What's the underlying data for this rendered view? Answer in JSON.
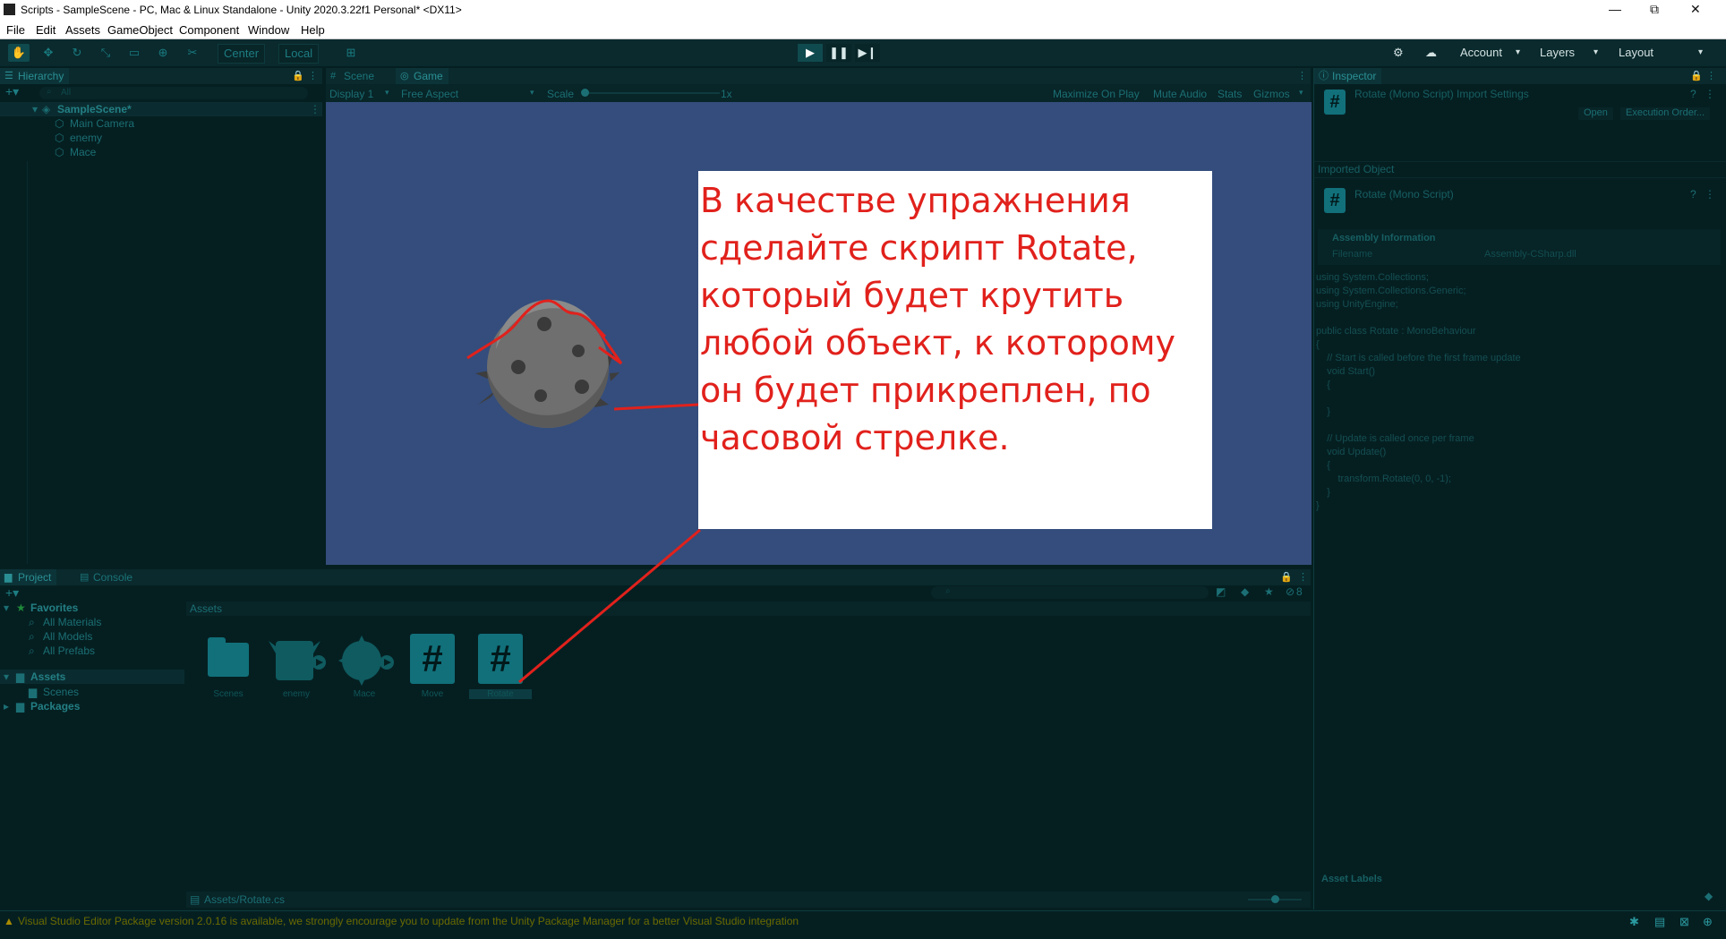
{
  "window": {
    "title": "Scripts - SampleScene - PC, Mac & Linux Standalone - Unity 2020.3.22f1 Personal* <DX11>",
    "controls": {
      "minimize": "—",
      "maximize": "⧉",
      "close": "✕"
    }
  },
  "menu": [
    "File",
    "Edit",
    "Assets",
    "GameObject",
    "Component",
    "Window",
    "Help"
  ],
  "toolbar": {
    "pivot": "Center",
    "space": "Local",
    "account": "Account",
    "layers": "Layers",
    "layout": "Layout"
  },
  "hierarchy": {
    "tab": "Hierarchy",
    "search_placeholder": "All",
    "scene": "SampleScene*",
    "items": [
      "Main Camera",
      "enemy",
      "Mace"
    ]
  },
  "scene_panel": {
    "tabs": [
      "Scene",
      "Game"
    ],
    "display": "Display 1",
    "aspect": "Free Aspect",
    "scale_label": "Scale",
    "scale_value": "1x",
    "toggles": [
      "Maximize On Play",
      "Mute Audio",
      "Stats",
      "Gizmos"
    ]
  },
  "overlay_text": "В качестве упражнения сделайте скрипт Rotate, который будет крутить любой объект, к которому он будет прикреплен, по часовой стрелке.",
  "overlay_color": "#e1211c",
  "inspector": {
    "tab": "Inspector",
    "header": "Rotate (Mono Script) Import Settings",
    "open_button": "Open",
    "exec_order_button": "Execution Order...",
    "imported_object": "Imported Object",
    "object_name": "Rotate (Mono Script)",
    "assembly_info": "Assembly Information",
    "filename_label": "Filename",
    "filename_value": "Assembly-CSharp.dll",
    "code_lines": [
      "using System.Collections;",
      "using System.Collections.Generic;",
      "using UnityEngine;",
      "",
      "public class Rotate : MonoBehaviour",
      "{",
      "    // Start is called before the first frame update",
      "    void Start()",
      "    {",
      "",
      "    }",
      "",
      "    // Update is called once per frame",
      "    void Update()",
      "    {",
      "        transform.Rotate(0, 0, -1);",
      "    }",
      "}"
    ],
    "asset_labels": "Asset Labels"
  },
  "project": {
    "tabs": [
      "Project",
      "Console"
    ],
    "favorites": "Favorites",
    "favorite_items": [
      "All Materials",
      "All Models",
      "All Prefabs"
    ],
    "assets": "Assets",
    "asset_children": [
      "Scenes"
    ],
    "packages": "Packages",
    "breadcrumb": "Assets",
    "asset_items": [
      "Scenes",
      "enemy",
      "Mace",
      "Move",
      "Rotate"
    ],
    "hidden_count": "8",
    "path": "Assets/Rotate.cs"
  },
  "status": {
    "message": "Visual Studio Editor Package version 2.0.16 is available, we strongly encourage you to update from the Unity Package Manager for a better Visual Studio integration"
  }
}
